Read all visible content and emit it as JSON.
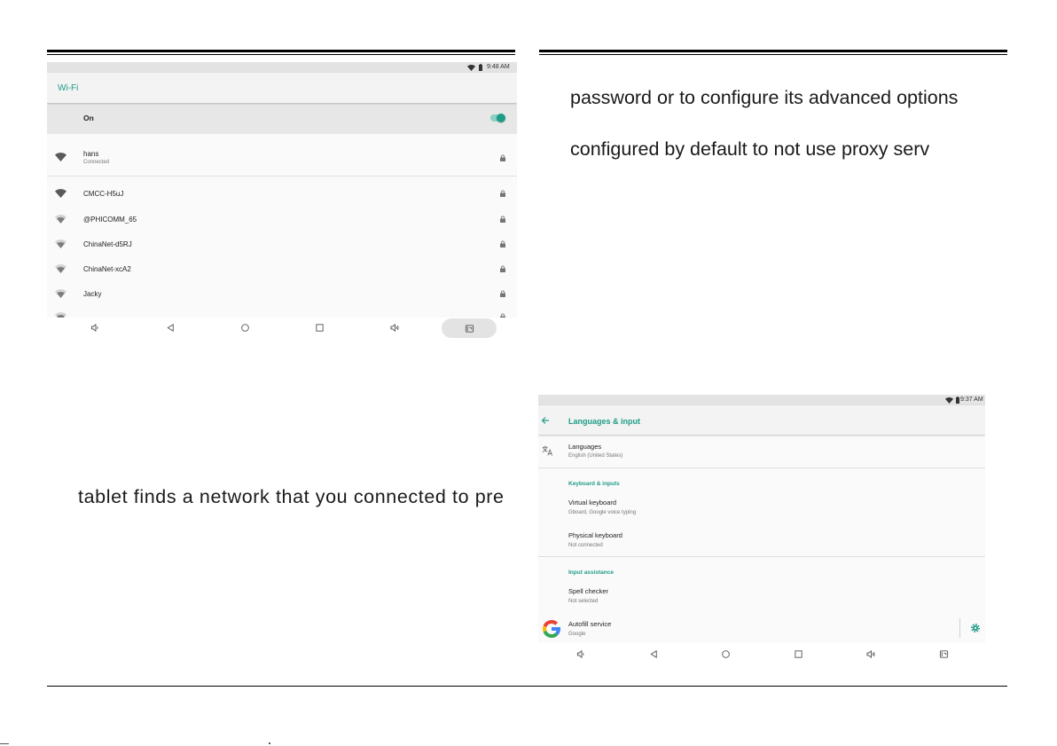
{
  "document": {
    "right_column_lines": [
      "password or to configure its advanced options",
      "configured by default to not use proxy serv"
    ],
    "left_column_line": "tablet finds a network that you connected to pre"
  },
  "colors": {
    "accent": "#1e9c87",
    "text": "#1a1a1a",
    "secondary_text": "#757575",
    "google_red": "#ea4335",
    "google_yellow": "#fbbc05",
    "google_green": "#34a853",
    "google_blue": "#4285f4"
  },
  "wifi_screenshot": {
    "status_bar": {
      "time": "9:48 AM",
      "icons": [
        "wifi-icon",
        "battery-icon"
      ]
    },
    "title": "Wi-Fi",
    "master_switch": {
      "label": "On",
      "checked": true
    },
    "networks": [
      {
        "name": "hans",
        "summary": "Connected",
        "signal": "full",
        "secured": true
      },
      {
        "name": "CMCC-H5uJ",
        "signal": "full",
        "secured": true
      },
      {
        "name": "@PHICOMM_65",
        "signal": "partial",
        "secured": true
      },
      {
        "name": "ChinaNet-d5RJ",
        "signal": "partial",
        "secured": true
      },
      {
        "name": "ChinaNet-xcA2",
        "signal": "partial",
        "secured": true
      },
      {
        "name": "Jacky",
        "signal": "partial",
        "secured": true
      },
      {
        "signal": "partial",
        "secured": true
      }
    ],
    "nav_bar": {
      "buttons": [
        "volume-down-icon",
        "back-icon",
        "home-icon",
        "recents-icon",
        "volume-up-icon",
        "screenshot-icon"
      ],
      "highlighted": "screenshot-icon"
    }
  },
  "languages_screenshot": {
    "status_bar": {
      "time": "9:37 AM",
      "icons": [
        "wifi-icon",
        "battery-icon"
      ]
    },
    "title": "Languages & input",
    "back_icon": "arrow-back-icon",
    "languages": {
      "title": "Languages",
      "summary": "English (United States)",
      "icon": "translate-icon"
    },
    "sections": [
      {
        "header": "Keyboard & inputs",
        "items": [
          {
            "title": "Virtual keyboard",
            "summary": "Gboard, Google voice typing"
          },
          {
            "title": "Physical keyboard",
            "summary": "Not connected"
          }
        ]
      },
      {
        "header": "Input assistance",
        "items": [
          {
            "title": "Spell checker",
            "summary": "Not selected"
          },
          {
            "title": "Autofill service",
            "summary": "Google",
            "icon": "google-g-icon",
            "action_icon": "gear-icon"
          }
        ]
      }
    ],
    "nav_bar": {
      "buttons": [
        "volume-down-icon",
        "back-icon",
        "home-icon",
        "recents-icon",
        "volume-up-icon",
        "screenshot-icon"
      ]
    }
  }
}
